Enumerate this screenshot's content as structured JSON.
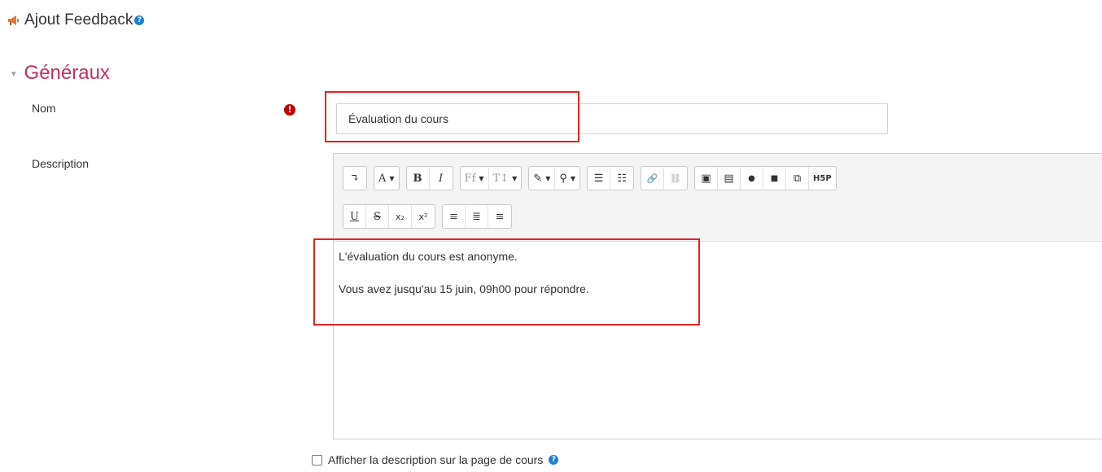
{
  "header": {
    "title": "Ajout Feedback",
    "help_glyph": "?"
  },
  "section": {
    "toggle_glyph": "▾",
    "title": "Généraux"
  },
  "name_field": {
    "label": "Nom",
    "required_glyph": "!",
    "value": "Évaluation du cours"
  },
  "description_field": {
    "label": "Description",
    "toolbar_row1": [
      {
        "name": "collapse",
        "glyph": "↴"
      },
      {
        "name": "text-style",
        "glyph": "A",
        "dropdown": true
      },
      {
        "name": "bold",
        "glyph": "B"
      },
      {
        "name": "italic",
        "glyph": "I"
      },
      {
        "name": "font-family",
        "glyph": "Ff",
        "dropdown": true
      },
      {
        "name": "font-size",
        "glyph": "T↕",
        "dropdown": true
      },
      {
        "name": "brush",
        "glyph": "✎",
        "dropdown": true
      },
      {
        "name": "lightbulb",
        "glyph": "⚲",
        "dropdown": true
      },
      {
        "name": "bullet-list",
        "glyph": "☰"
      },
      {
        "name": "numbered-list",
        "glyph": "☷"
      },
      {
        "name": "link",
        "glyph": "🔗"
      },
      {
        "name": "unlink",
        "glyph": "⛓"
      },
      {
        "name": "image",
        "glyph": "▣"
      },
      {
        "name": "media",
        "glyph": "▤"
      },
      {
        "name": "record-audio",
        "glyph": "●"
      },
      {
        "name": "record-video",
        "glyph": "■"
      },
      {
        "name": "manage-files",
        "glyph": "⧉"
      },
      {
        "name": "h5p",
        "glyph": "H5P"
      }
    ],
    "toolbar_row2": [
      {
        "name": "underline",
        "glyph": "U"
      },
      {
        "name": "strikethrough",
        "glyph": "S"
      },
      {
        "name": "subscript",
        "glyph": "x₂"
      },
      {
        "name": "superscript",
        "glyph": "x²"
      },
      {
        "name": "align-left",
        "glyph": "≡"
      },
      {
        "name": "align-center",
        "glyph": "≣"
      },
      {
        "name": "align-right",
        "glyph": "≡"
      }
    ],
    "content": [
      "L'évaluation du cours est anonyme.",
      "Vous avez jusqu'au 15 juin, 09h00 pour répondre."
    ]
  },
  "show_description": {
    "label": "Afficher la description sur la page de cours",
    "checked": false,
    "help_glyph": "?"
  },
  "colors": {
    "section_title": "#c62e5c",
    "highlight": "#e32222",
    "help": "#1f7fd0",
    "required": "#c00000"
  }
}
